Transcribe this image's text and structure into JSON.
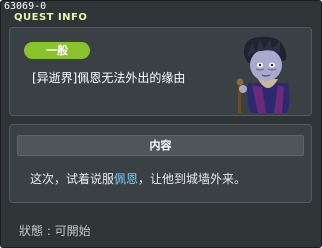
{
  "window": {
    "quest_id": "63069-0",
    "title": "QUEST INFO"
  },
  "quest": {
    "category": "一般",
    "title": "[异逝界]佩恩无法外出的缘由",
    "npc_portrait_icon": "npc-zombie-old-man-icon"
  },
  "content": {
    "header": "内容",
    "desc_before": "这次，试着说服",
    "npc_name": "佩恩",
    "desc_after": "，让他到城墙外来。"
  },
  "status": {
    "text": "狀態 : 可開始"
  },
  "colors": {
    "window_bg": "#2f3437",
    "panel_bg": "#3a4145",
    "badge": "#8ac22c",
    "title_text": "#e9f4a8",
    "npc_link": "#6fd4ff"
  }
}
